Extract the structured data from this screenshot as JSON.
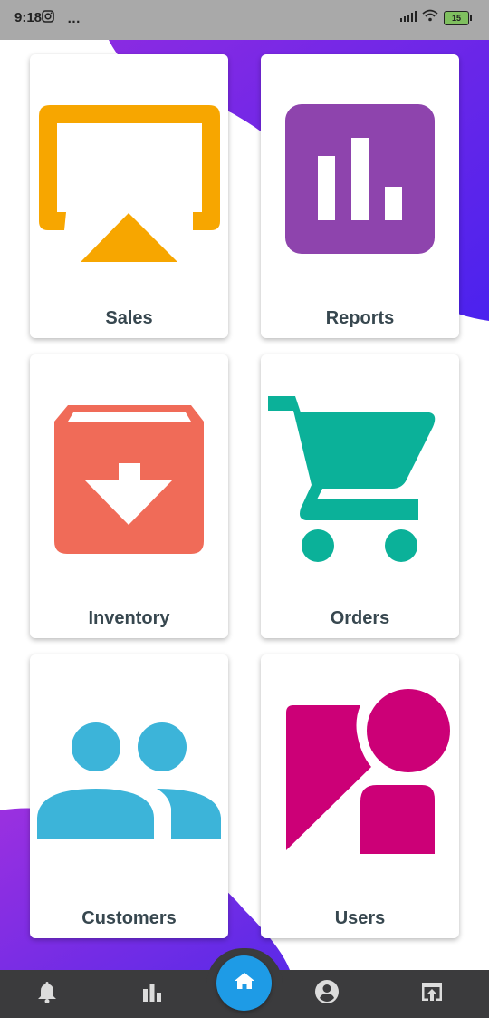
{
  "status_bar": {
    "time": "9:18",
    "battery": "15",
    "more": "…"
  },
  "tiles": [
    {
      "label": "Sales",
      "icon": "airplay-icon",
      "color": "#f7a600"
    },
    {
      "label": "Reports",
      "icon": "bar-chart-icon",
      "color": "#8e44ad"
    },
    {
      "label": "Inventory",
      "icon": "archive-box-icon",
      "color": "#f06b58"
    },
    {
      "label": "Orders",
      "icon": "shopping-cart-icon",
      "color": "#0bb199"
    },
    {
      "label": "Customers",
      "icon": "people-icon",
      "color": "#3cb4d9"
    },
    {
      "label": "Users",
      "icon": "user-profile-icon",
      "color": "#cc0077"
    }
  ],
  "bottom_nav": {
    "items": [
      "bell-icon",
      "bar-chart-icon",
      "home-icon",
      "account-icon",
      "upload-icon"
    ],
    "active": "home-icon",
    "active_color": "#1e9be6"
  }
}
